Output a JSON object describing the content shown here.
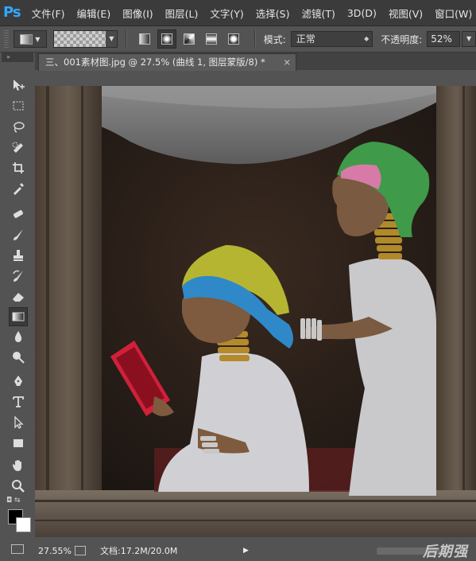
{
  "app": {
    "logo": "Ps",
    "menus": [
      "文件(F)",
      "编辑(E)",
      "图像(I)",
      "图层(L)",
      "文字(Y)",
      "选择(S)",
      "滤镜(T)",
      "3D(D)",
      "视图(V)",
      "窗口(W)"
    ]
  },
  "options": {
    "mode_label": "模式:",
    "mode_value": "正常",
    "opacity_label": "不透明度:",
    "opacity_value": "52%",
    "gradient_styles": [
      "linear-gradient-icon",
      "radial-gradient-icon",
      "angle-gradient-icon",
      "reflected-gradient-icon",
      "diamond-gradient-icon"
    ],
    "active_gradient_style": "radial-gradient-icon"
  },
  "toolbar": {
    "collapse_glyph": "»",
    "tools": [
      "move-tool",
      "marquee-tool",
      "lasso-tool",
      "quick-selection-tool",
      "crop-tool",
      "eyedropper-tool",
      "spot-healing-tool",
      "brush-tool",
      "clone-stamp-tool",
      "history-brush-tool",
      "eraser-tool",
      "gradient-tool",
      "blur-tool",
      "dodge-tool",
      "pen-tool",
      "type-tool",
      "path-selection-tool",
      "rectangle-tool",
      "hand-tool",
      "zoom-tool"
    ],
    "active_tool": "gradient-tool",
    "foreground_color": "#000000",
    "background_color": "#ffffff"
  },
  "document": {
    "tab_title": "三、001素材图.jpg @ 27.5% (曲线 1, 图层蒙版/8) *",
    "close_glyph": "×"
  },
  "status": {
    "zoom": "27.55%",
    "doc_info": "文档:17.2M/20.0M",
    "arrow": "▶"
  },
  "watermark": "后期强"
}
